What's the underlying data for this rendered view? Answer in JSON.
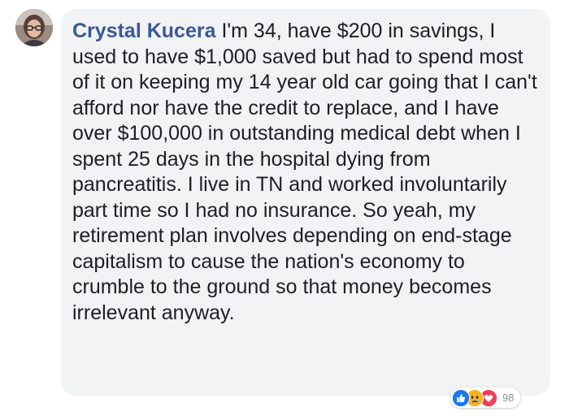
{
  "comment": {
    "author": "Crystal Kucera",
    "text": "I'm 34, have $200 in savings, I used to have $1,000 saved but had to spend most of it on keeping my 14 year old car going that I can't afford nor have the credit to replace, and I have over $100,000 in outstanding medical debt when I spent 25 days in the hospital dying from pancreatitis. I live in TN and worked involuntarily part time so I had no insurance. So yeah, my retirement plan involves depending on end-stage capitalism to cause the nation's economy to crumble to the ground so that money becomes irrelevant anyway.",
    "reactions": {
      "icons": [
        "like-icon",
        "sad-icon",
        "love-icon"
      ],
      "count": "98"
    }
  },
  "colors": {
    "author": "#385898",
    "text": "#1c1e21",
    "bubble": "#f2f3f5",
    "like": "#1877f2",
    "sad": "#f7b125",
    "love": "#f33e58",
    "count": "#90949c"
  }
}
